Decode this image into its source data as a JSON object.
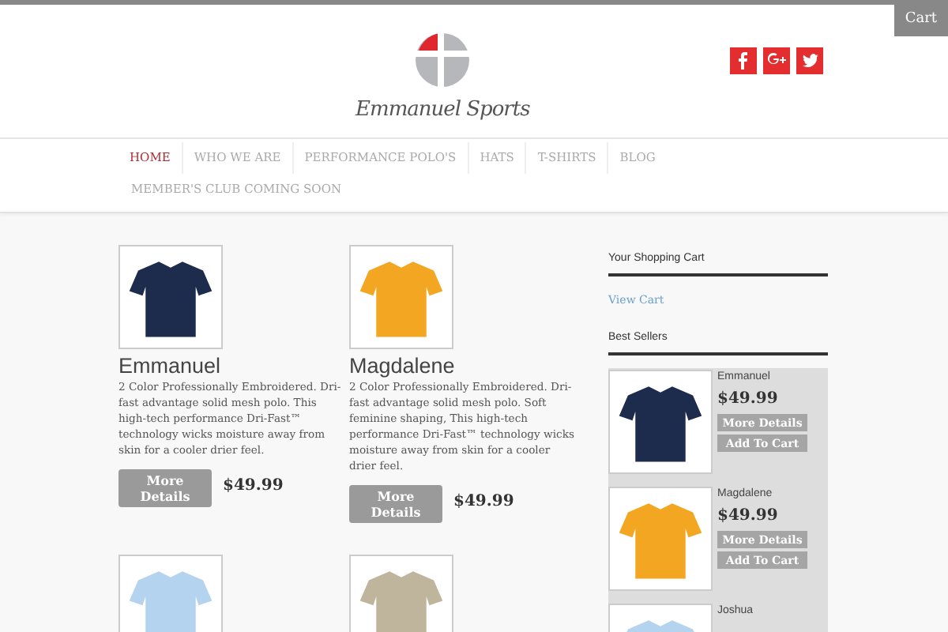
{
  "cart_tab": "Cart",
  "logo": {
    "text": "Emmanuel Sports"
  },
  "social": [
    {
      "kind": "facebook"
    },
    {
      "kind": "googleplus"
    },
    {
      "kind": "twitter"
    }
  ],
  "nav": [
    {
      "label": "HOME",
      "selected": true
    },
    {
      "label": "WHO WE ARE",
      "selected": false
    },
    {
      "label": "PERFORMANCE POLO'S",
      "selected": false
    },
    {
      "label": "HATS",
      "selected": false
    },
    {
      "label": "T-SHIRTS",
      "selected": false
    },
    {
      "label": "BLOG",
      "selected": false
    },
    {
      "label": "MEMBER'S CLUB COMING SOON",
      "selected": false
    }
  ],
  "products": [
    {
      "color": "#1d2b4d",
      "name": "Emmanuel",
      "description": "2 Color Professionally Embroidered. Dri-fast advantage solid mesh polo. This high-tech performance Dri-Fast™ technology wicks moisture away from skin for a cooler drier feel.",
      "button": "More Details",
      "price": "$49.99"
    },
    {
      "color": "#f2a622",
      "name": "Magdalene",
      "description": "2 Color Professionally Embroidered. Dri-fast advantage solid mesh polo. Soft feminine shaping, This high-tech performance Dri-Fast™ technology wicks moisture away from skin for a cooler drier feel.",
      "button": "More Details",
      "price": "$49.99"
    },
    {
      "color": "#b4d3ef"
    },
    {
      "color": "#bfb59c"
    }
  ],
  "sidebar": {
    "cart_title": "Your Shopping Cart",
    "cart_link": "View Cart",
    "best_title": "Best Sellers",
    "best_sellers": [
      {
        "color": "#1d2b4d",
        "name": "Emmanuel",
        "price": "$49.99",
        "details_button": "More Details",
        "cart_button": "Add To Cart"
      },
      {
        "color": "#f2a622",
        "name": "Magdalene",
        "price": "$49.99",
        "details_button": "More Details",
        "cart_button": "Add To Cart"
      },
      {
        "color": "#b4d3ef",
        "name": "Joshua"
      }
    ]
  }
}
